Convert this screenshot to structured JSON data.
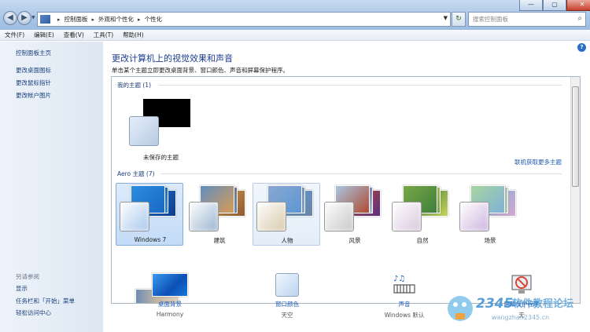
{
  "address_bar": {
    "crumbs": [
      "控制面板",
      "外观和个性化",
      "个性化"
    ]
  },
  "search": {
    "placeholder": "搜索控制面板"
  },
  "window_controls": {
    "minimize": "—",
    "maximize": "▢",
    "close": "✕"
  },
  "menu": {
    "items": [
      "文件(F)",
      "编辑(E)",
      "查看(V)",
      "工具(T)",
      "帮助(H)"
    ]
  },
  "sidebar": {
    "home": "控制面板主页",
    "links": [
      "更改桌面图标",
      "更改鼠标指针",
      "更改帐户图片"
    ],
    "see_also_title": "另请参阅",
    "see_also": [
      "显示",
      "任务栏和「开始」菜单",
      "轻松访问中心"
    ]
  },
  "main": {
    "title": "更改计算机上的视觉效果和声音",
    "description": "单击某个主题立即更改桌面背景、窗口颜色、声音和屏幕保护程序。",
    "my_themes_heading": "我的主题 (1)",
    "unsaved_theme_label": "未保存的主题",
    "online_link": "联机获取更多主题",
    "aero_heading": "Aero 主题 (7)",
    "aero_themes": [
      {
        "label": "Windows 7",
        "selected": true,
        "bg": [
          "#1b68c4",
          "#0d3f8f",
          "#2b8fe0"
        ],
        "swatch": "#a9c8ec"
      },
      {
        "label": "建筑",
        "selected": false,
        "bg": [
          "#d89a53",
          "#8e5b2e",
          "#5f8fc0"
        ],
        "swatch": "#9cb4d0"
      },
      {
        "label": "人物",
        "selected": false,
        "hover": true,
        "bg": [
          "#5d97d6",
          "#6a86a8",
          "#89a7cf"
        ],
        "swatch": "#d8c9a9"
      },
      {
        "label": "风景",
        "selected": false,
        "bg": [
          "#b04a31",
          "#5f2f83",
          "#a8c7e2"
        ],
        "swatch": "#c7c7c7"
      },
      {
        "label": "自然",
        "selected": false,
        "bg": [
          "#3e7f3a",
          "#c9d35a",
          "#78a746"
        ],
        "swatch": "#d9c8dd"
      },
      {
        "label": "场景",
        "selected": false,
        "bg": [
          "#7fb1d6",
          "#d6a7cf",
          "#a7d5a0"
        ],
        "swatch": "#cdb5df"
      }
    ]
  },
  "bottom": [
    {
      "name": "desktop-background",
      "label": "桌面背景",
      "value": "Harmony"
    },
    {
      "name": "window-color",
      "label": "窗口颜色",
      "value": "天空"
    },
    {
      "name": "sounds",
      "label": "声音",
      "value": "Windows 默认"
    },
    {
      "name": "screen-saver",
      "label": "屏幕保护程序",
      "value": "无"
    }
  ],
  "watermark": {
    "brand": "2345",
    "text": "软件教程论坛",
    "url": "wangzhan2345.cn"
  },
  "colors": {
    "link": "#1b59b4",
    "title": "#1b3d8f",
    "selection": "#c3dbf7"
  }
}
